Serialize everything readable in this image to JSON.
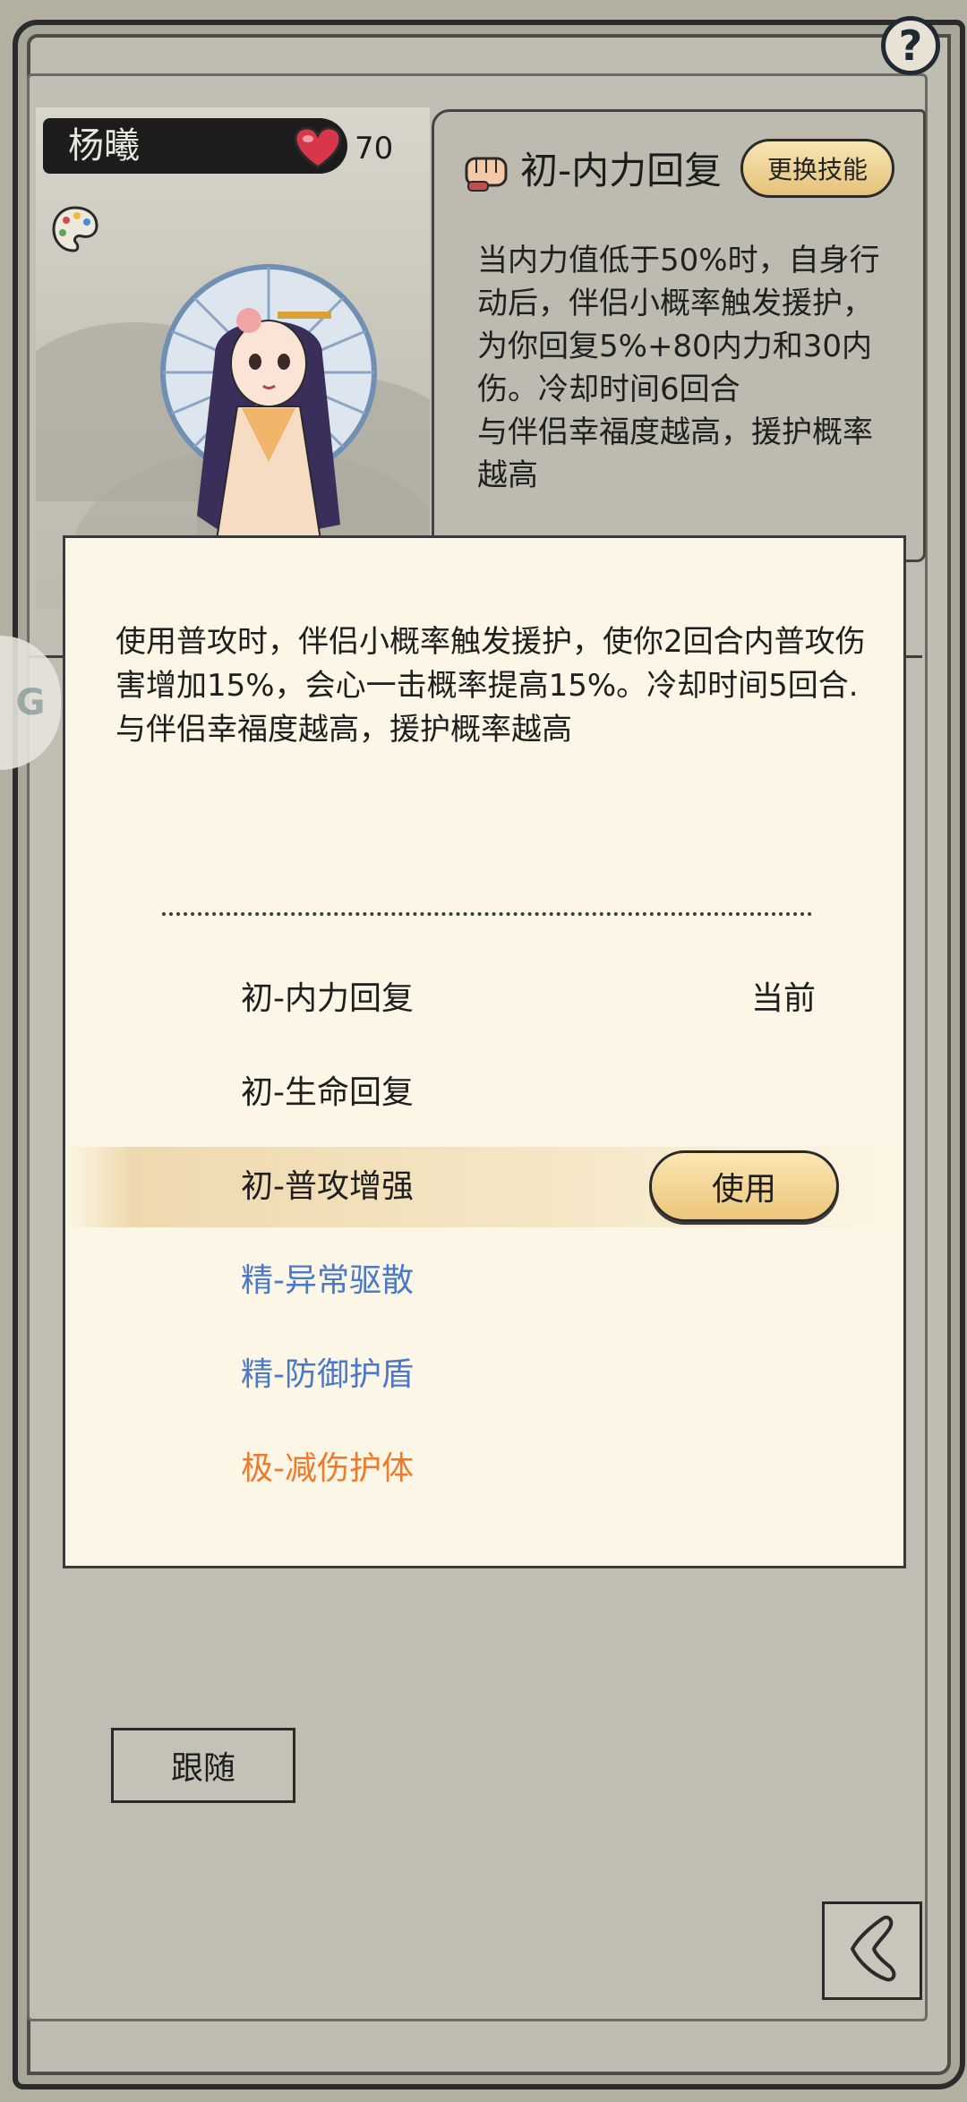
{
  "character": {
    "name": "杨曦",
    "affection": "70",
    "icons": {
      "affection": "heart-icon",
      "wardrobe": "palette-icon"
    }
  },
  "skill_card": {
    "title": "初-内力回复",
    "change_button": "更换技能",
    "description": "当内力值低于50%时，自身行动后，伴侣小概率触发援护，为你回复5%+80内力和30内伤。冷却时间6回合\n与伴侣幸福度越高，援护概率越高"
  },
  "help_button": "?",
  "modal": {
    "description": "使用普攻时，伴侣小概率触发援护，使你2回合内普攻伤害增加15%，会心一击概率提高15%。冷却时间5回合.\n与伴侣幸福度越高，援护概率越高",
    "skills": [
      {
        "label": "初-内力回复",
        "tag": "当前",
        "color": "#1e1e1e"
      },
      {
        "label": "初-生命回复",
        "color": "#1e1e1e"
      },
      {
        "label": "初-普攻增强",
        "button": "使用",
        "color": "#1e1e1e"
      },
      {
        "label": "精-异常驱散",
        "color": "#4a79c8"
      },
      {
        "label": "精-防御护盾",
        "color": "#4a79c8"
      },
      {
        "label": "极-减伤护体",
        "color": "#f07a2a"
      }
    ]
  },
  "follow_button": "跟随",
  "back_icon": "back-icon"
}
